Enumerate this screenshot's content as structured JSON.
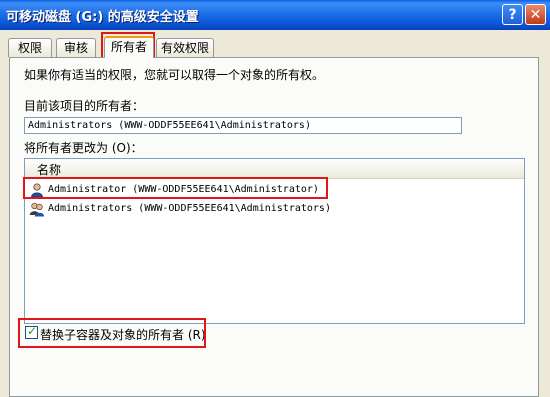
{
  "window": {
    "title": "可移动磁盘 (G:) 的高级安全设置"
  },
  "titlebar_buttons": {
    "help": "?",
    "close": "✕"
  },
  "tabs": [
    {
      "label": "权限"
    },
    {
      "label": "审核"
    },
    {
      "label": "所有者",
      "active": true
    },
    {
      "label": "有效权限"
    }
  ],
  "owner_page": {
    "intro": "如果你有适当的权限，您就可以取得一个对象的所有权。",
    "current_owner_label": "目前该项目的所有者：",
    "current_owner_value": "Administrators (WWW-ODDF55EE641\\Administrators)",
    "change_owner_label": "将所有者更改为 (O)：",
    "list": {
      "column_header": "名称",
      "items": [
        {
          "label": "Administrator (WWW-ODDF55EE641\\Administrator)",
          "icon": "user-icon"
        },
        {
          "label": "Administrators (WWW-ODDF55EE641\\Administrators)",
          "icon": "group-icon"
        }
      ]
    },
    "replace_checkbox": {
      "label": "替换子容器及对象的所有者 (R)",
      "checked": true
    }
  },
  "colors": {
    "highlight_box": "#e0171a",
    "titlebar": "#0a55d6"
  }
}
